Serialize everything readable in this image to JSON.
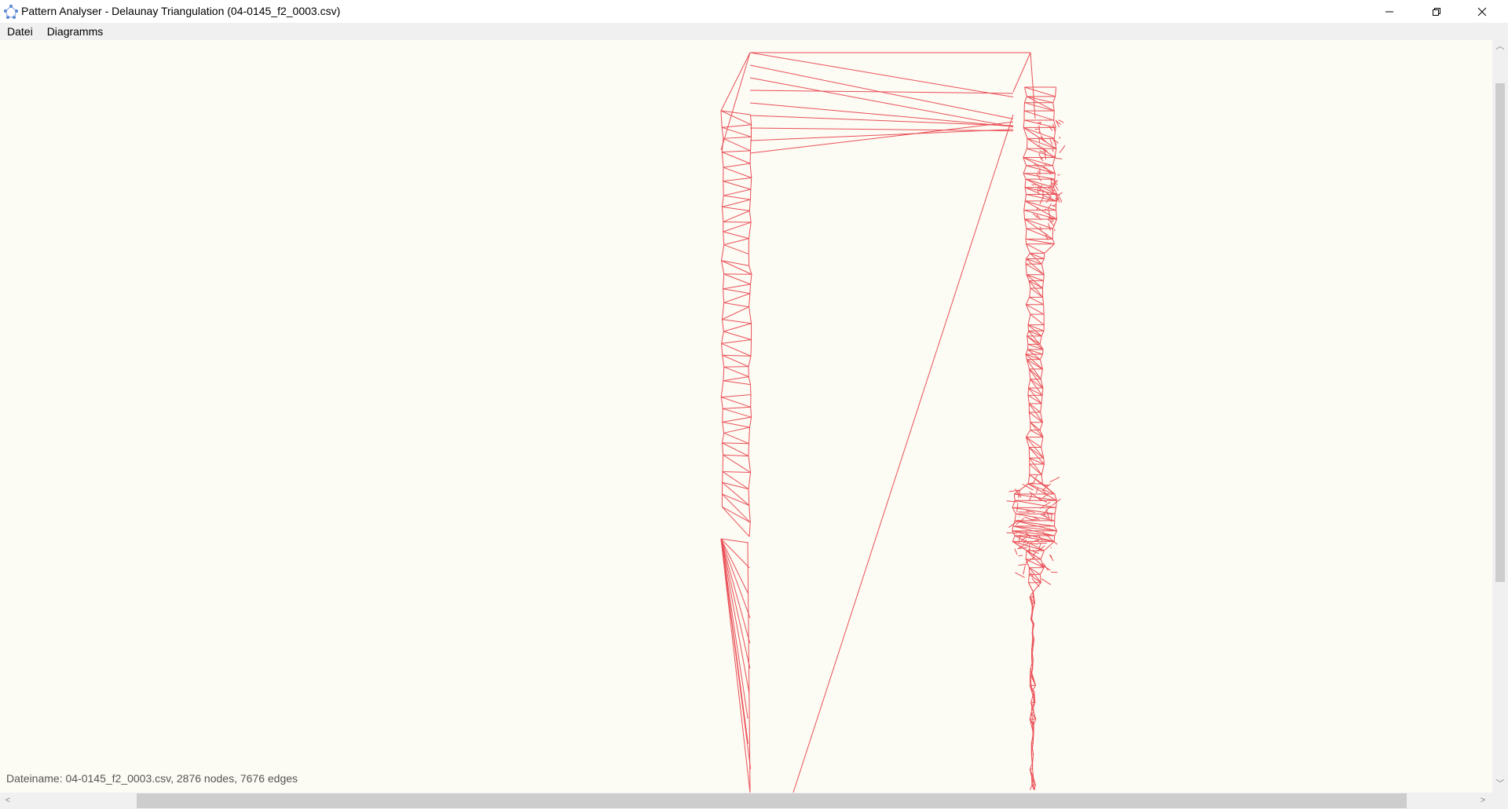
{
  "window": {
    "title": "Pattern Analyser - Delaunay Triangulation (04-0145_f2_0003.csv)"
  },
  "menu": {
    "items": [
      {
        "label": "Datei"
      },
      {
        "label": "Diagramms"
      }
    ]
  },
  "status": {
    "text": "Dateiname: 04-0145_f2_0003.csv, 2876 nodes, 7676 edges"
  },
  "colors": {
    "edge": "#e8323c",
    "background": "#fcfbf4"
  },
  "icons": {
    "minimize": "minimize-icon",
    "maximize": "restore-icon",
    "close": "close-icon"
  }
}
